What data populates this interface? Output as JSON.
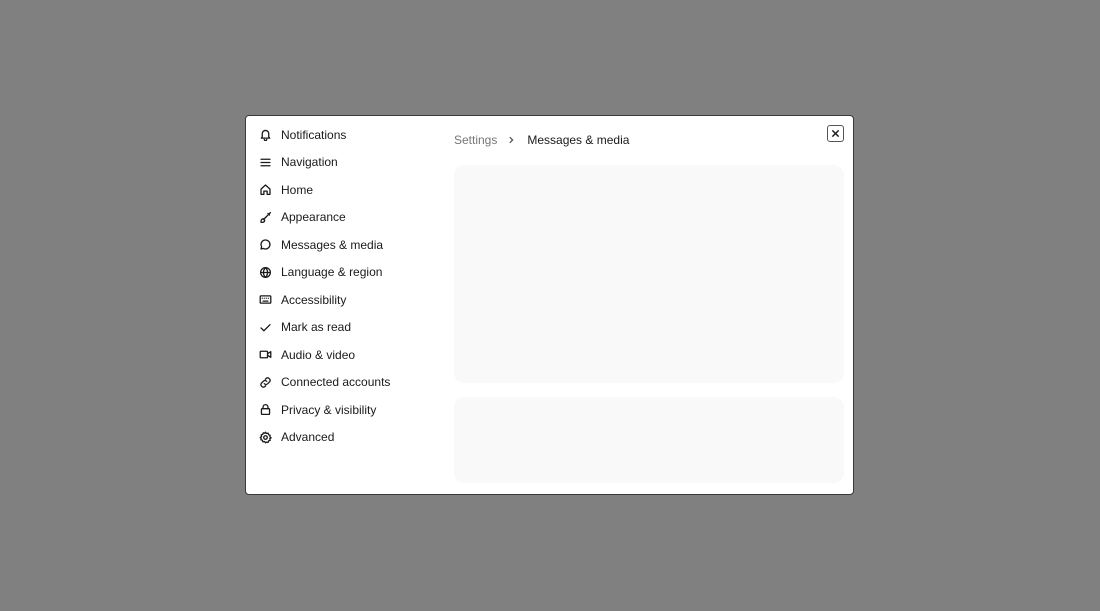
{
  "sidebar": {
    "items": [
      {
        "label": "Notifications",
        "icon": "bell-icon"
      },
      {
        "label": "Navigation",
        "icon": "menu-icon"
      },
      {
        "label": "Home",
        "icon": "home-icon"
      },
      {
        "label": "Appearance",
        "icon": "brush-icon"
      },
      {
        "label": "Messages & media",
        "icon": "message-icon"
      },
      {
        "label": "Language & region",
        "icon": "globe-icon"
      },
      {
        "label": "Accessibility",
        "icon": "keyboard-icon"
      },
      {
        "label": "Mark as read",
        "icon": "check-icon"
      },
      {
        "label": "Audio & video",
        "icon": "video-icon"
      },
      {
        "label": "Connected accounts",
        "icon": "link-icon"
      },
      {
        "label": "Privacy & visibility",
        "icon": "lock-icon"
      },
      {
        "label": "Advanced",
        "icon": "gear-icon"
      }
    ]
  },
  "breadcrumb": {
    "root": "Settings",
    "current": "Messages & media"
  },
  "colors": {
    "overlay": "#808080",
    "dialog_bg": "#ffffff",
    "panel_bg": "#f9f9f9",
    "text": "#1a1a1a",
    "muted_text": "#767676"
  }
}
